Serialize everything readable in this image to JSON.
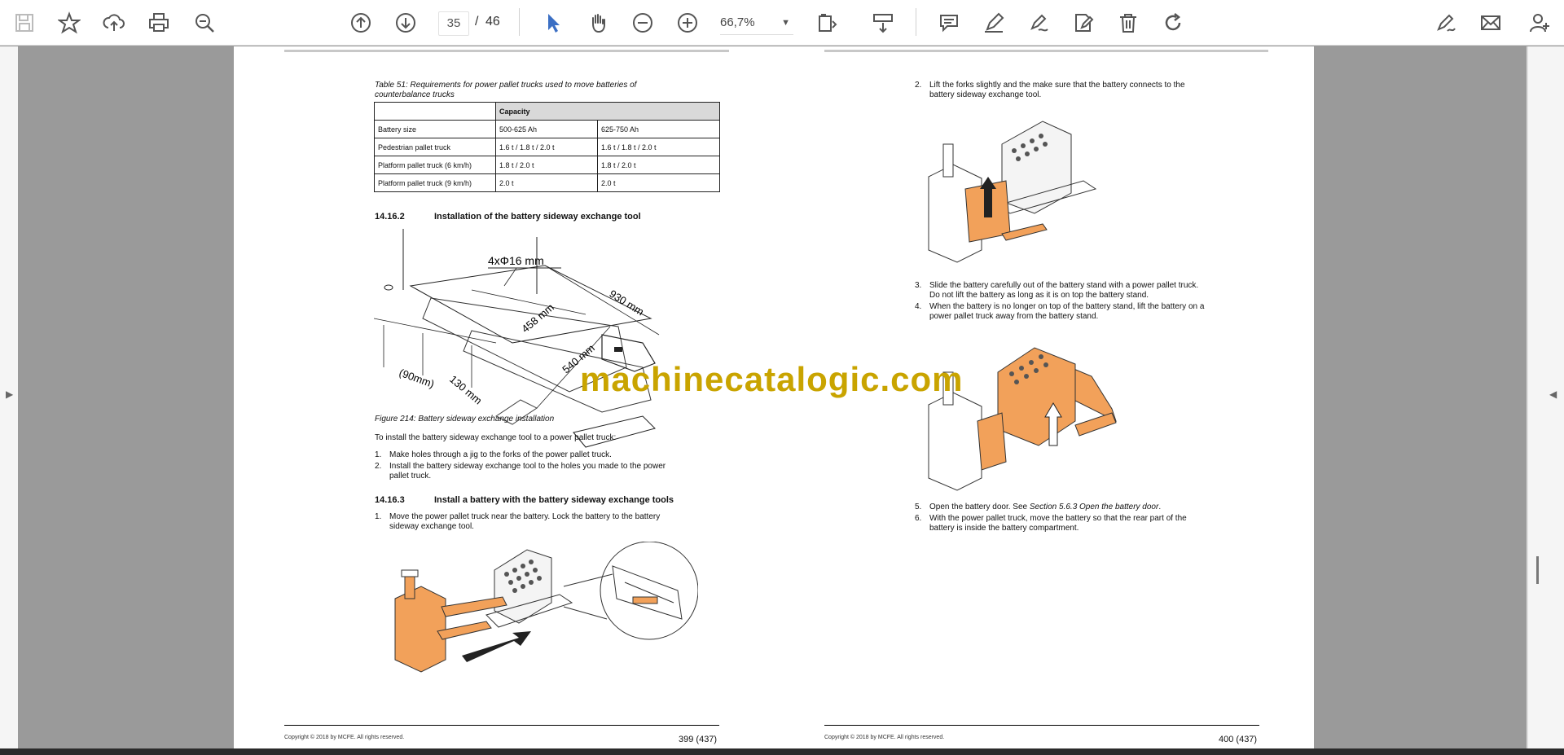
{
  "toolbar": {
    "page_current": "35",
    "page_separator": "/",
    "page_total": "46",
    "zoom": "66,7%"
  },
  "page_left": {
    "table_caption": "Table 51:  Requirements for power pallet trucks used to move batteries of counterbalance trucks",
    "table": {
      "header": "Capacity",
      "rows": [
        [
          "Battery size",
          "500-625 Ah",
          "625-750 Ah"
        ],
        [
          "Pedestrian pallet truck",
          "1.6 t / 1.8 t / 2.0 t",
          "1.6 t / 1.8 t / 2.0 t"
        ],
        [
          "Platform pallet truck (6 km/h)",
          "1.8 t / 2.0 t",
          "1.8 t / 2.0 t"
        ],
        [
          "Platform pallet truck (9 km/h)",
          "2.0 t",
          "2.0 t"
        ]
      ]
    },
    "section1_num": "14.16.2",
    "section1_title": "Installation of the battery sideway exchange tool",
    "dims": {
      "holes": "4xΦ16 mm",
      "d930": "930 mm",
      "d458": "458 mm",
      "d540": "540 mm",
      "d90": "(90mm)",
      "d130": "130 mm"
    },
    "figure_caption": "Figure 214: Battery sideway exchange installation",
    "intro": "To install the battery sideway exchange tool to a power pallet truck:",
    "steps1": [
      {
        "n": "1.",
        "lines": [
          "Make holes through a jig to the forks of the power pallet truck."
        ]
      },
      {
        "n": "2.",
        "lines": [
          "Install the battery sideway exchange tool to the holes you made to the power",
          "pallet truck."
        ]
      }
    ],
    "section2_num": "14.16.3",
    "section2_title": "Install a battery with the battery sideway exchange tools",
    "steps2": [
      {
        "n": "1.",
        "lines": [
          "Move the power pallet truck near the battery. Lock the battery to the battery",
          "sideway exchange tool."
        ]
      }
    ],
    "copyright": "Copyright © 2018 by MCFE. All rights reserved.",
    "page_number": "399 (437)"
  },
  "page_right": {
    "step2": {
      "n": "2.",
      "lines": [
        "Lift the forks slightly and the make sure that the battery connects to the",
        "battery sideway exchange tool."
      ]
    },
    "step3": {
      "n": "3.",
      "lines": [
        "Slide the battery carefully out of the battery stand with a power pallet truck.",
        "Do not lift the battery as long as it is on top the battery stand."
      ]
    },
    "step4": {
      "n": "4.",
      "lines": [
        "When the battery is no longer on top of the battery stand, lift the battery on a",
        "power pallet truck away from the battery stand."
      ]
    },
    "step5": {
      "n": "5.",
      "prefix": "Open the battery door. See ",
      "ref": "Section 5.6.3 Open the battery door",
      "suffix": "."
    },
    "step6": {
      "n": "6.",
      "lines": [
        "With the power pallet truck, move the battery so that the rear part of the",
        "battery is inside the battery compartment."
      ]
    },
    "copyright": "Copyright © 2018 by MCFE. All rights reserved.",
    "page_number": "400 (437)"
  },
  "watermark": "machinecatalogic.com",
  "colors": {
    "accent": "#3b6fc4",
    "truck_orange": "#f2a15a",
    "watermark": "#c9a400"
  }
}
